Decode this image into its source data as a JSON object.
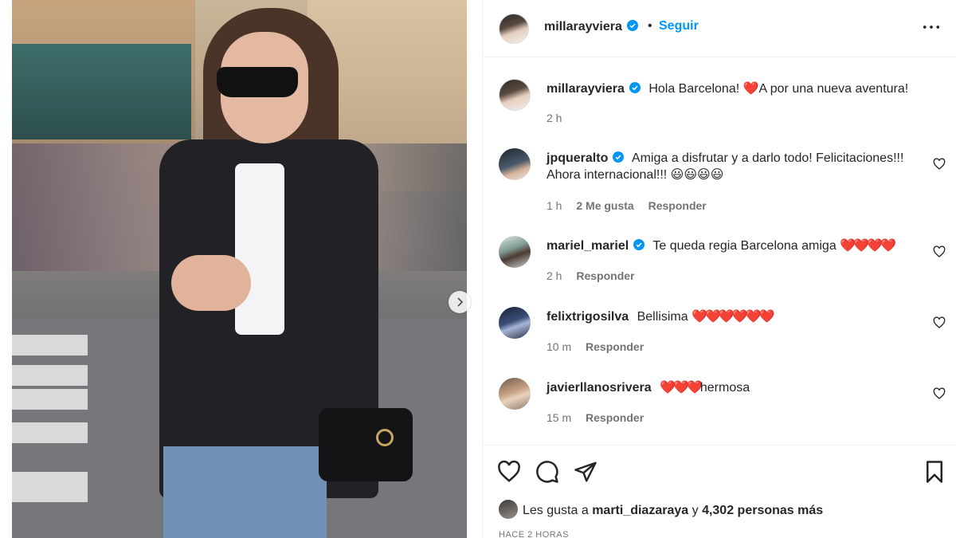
{
  "post": {
    "author": "millarayviera",
    "follow_label": "Seguir",
    "separator": "•",
    "caption": "Hola Barcelona! ❤️A por una nueva aventura!",
    "caption_time": "2 h"
  },
  "comments": [
    {
      "username": "jpqueralto",
      "verified": true,
      "text": "Amiga a disfrutar y a darlo todo! Felicitaciones!!! Ahora internacional!!! 😃😃😃😃",
      "time": "1 h",
      "likes": "2 Me gusta",
      "reply_label": "Responder"
    },
    {
      "username": "mariel_mariel",
      "verified": true,
      "text": "Te queda regia Barcelona amiga",
      "hearts": "❤️❤️❤️❤️",
      "time": "2 h",
      "reply_label": "Responder"
    },
    {
      "username": "felixtrigosilva",
      "verified": false,
      "text": "Bellisima",
      "hearts": "❤️❤️❤️❤️❤️❤️",
      "time": "10 m",
      "reply_label": "Responder"
    },
    {
      "username": "javierllanosrivera",
      "verified": false,
      "hearts": "❤️❤️❤️",
      "text": "hermosa",
      "time": "15 m",
      "reply_label": "Responder"
    }
  ],
  "likes": {
    "prefix": "Les gusta a",
    "first_user": "marti_diazaraya",
    "connector": "y",
    "others": "4,302 personas más"
  },
  "timestamp": "HACE 2 HORAS",
  "icons": {
    "more": "more-options-icon",
    "like": "heart-icon",
    "comment": "comment-icon",
    "share": "send-icon",
    "save": "bookmark-icon",
    "next": "chevron-right-icon"
  },
  "colors": {
    "accent": "#0095f6",
    "verified": "#0095f6",
    "heart": "#ed1c24"
  }
}
